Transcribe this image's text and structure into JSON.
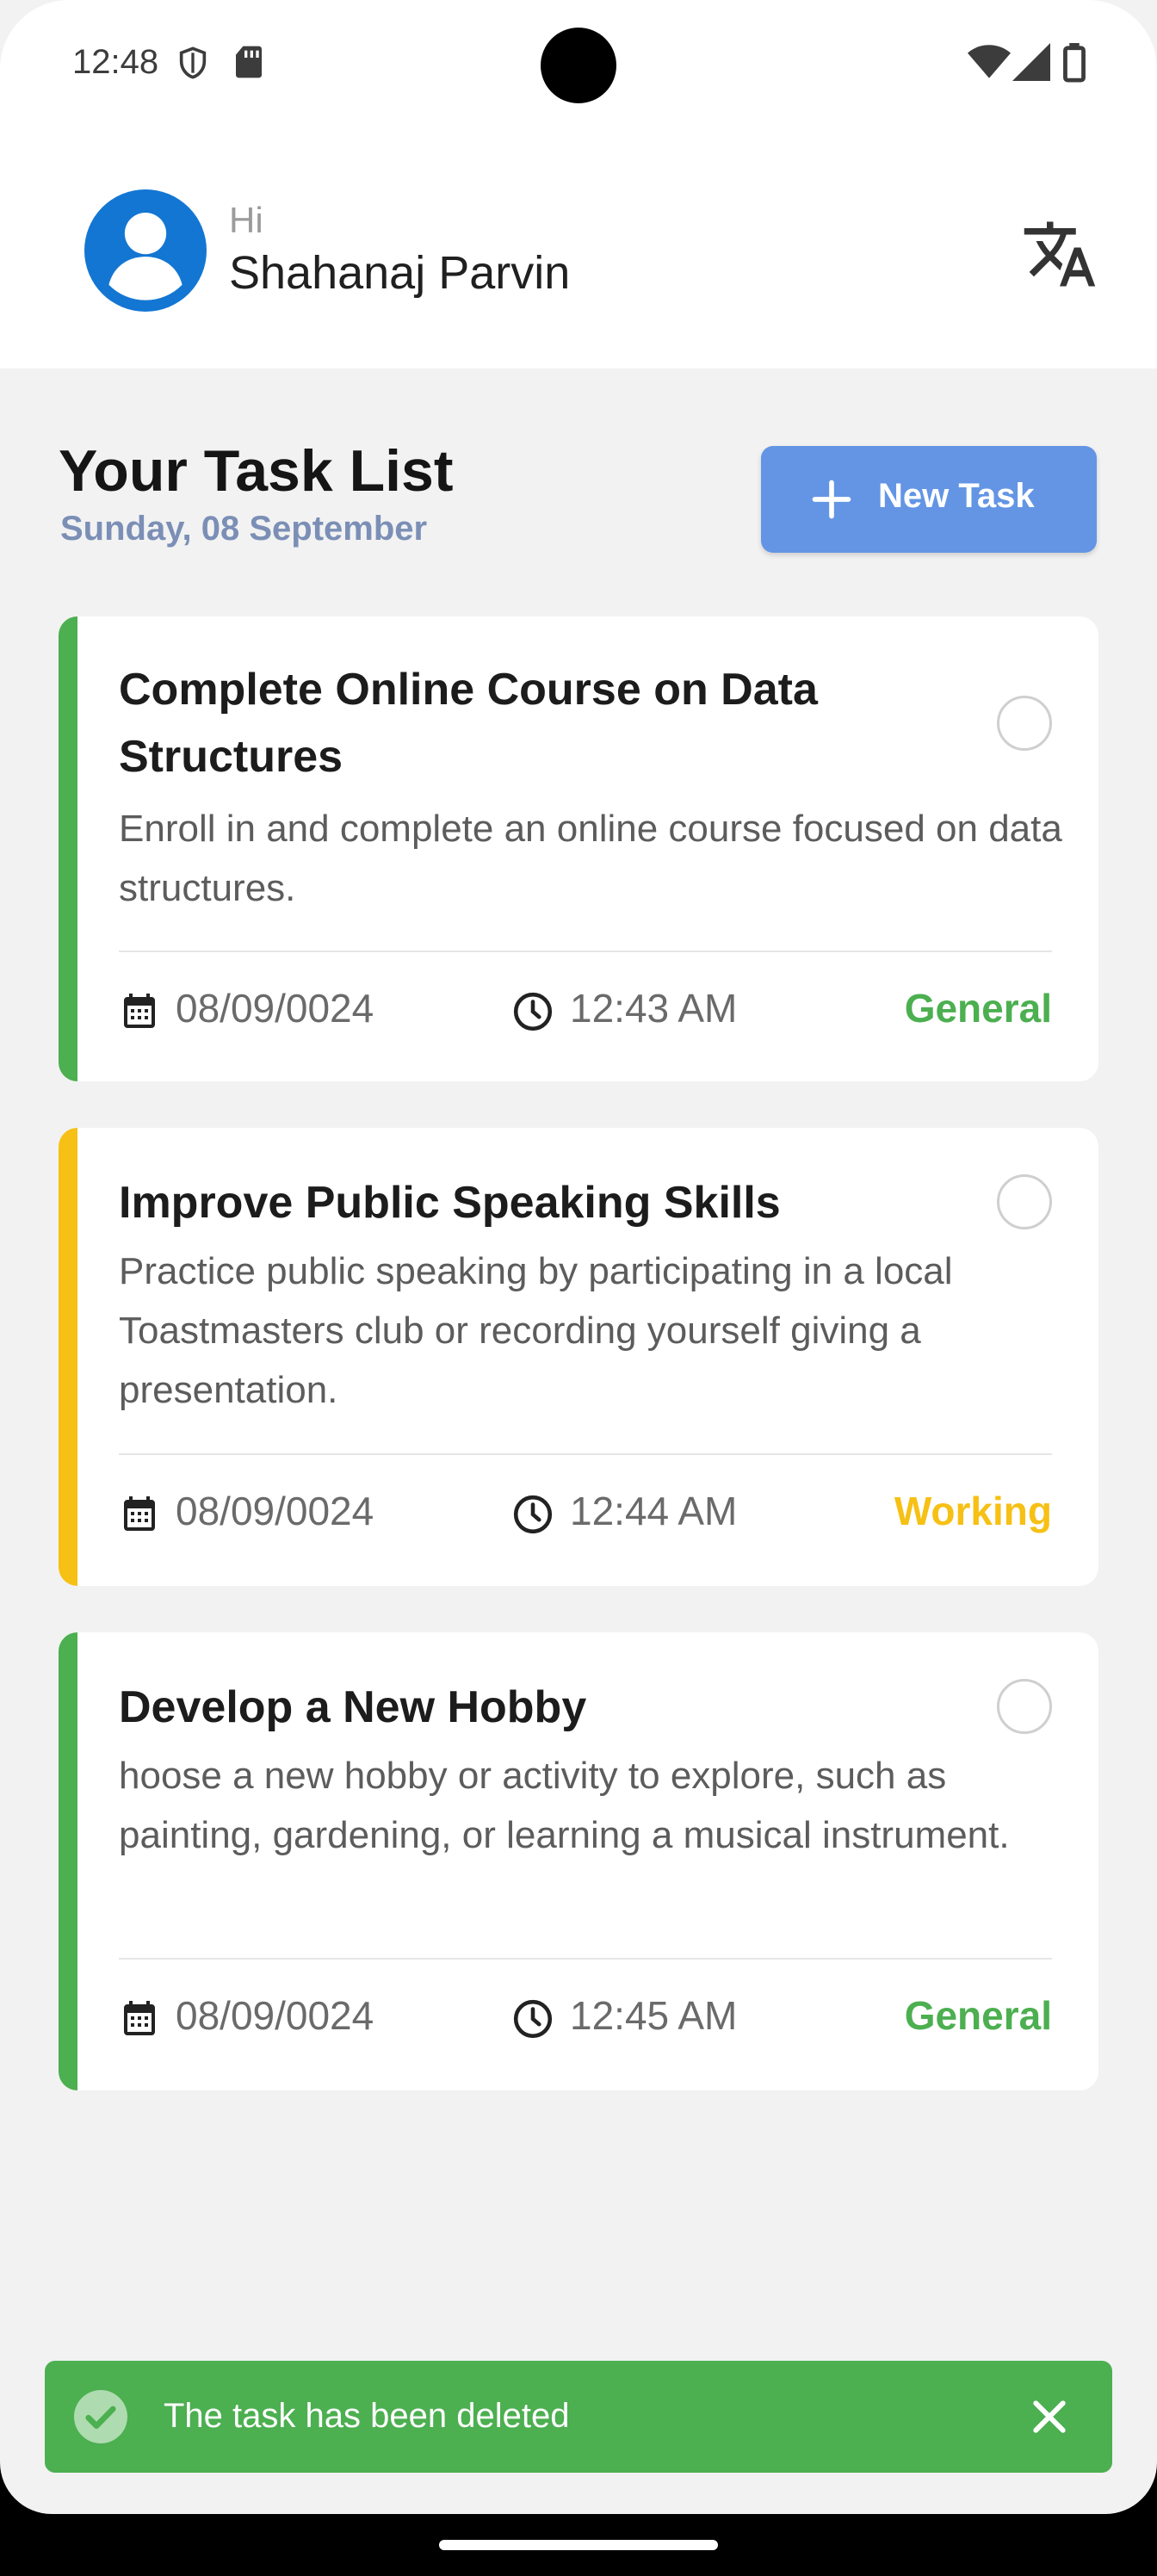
{
  "status_bar": {
    "time": "12:48"
  },
  "header": {
    "greeting": "Hi",
    "user_name": "Shahanaj Parvin"
  },
  "page": {
    "title": "Your Task List",
    "date": "Sunday, 08 September",
    "new_task_label": "New Task"
  },
  "tasks": [
    {
      "title": "Complete Online Course on Data Structures",
      "description": "Enroll in and complete an online course focused on data structures.",
      "date": "08/09/0024",
      "time": "12:43 AM",
      "category": "General",
      "color": "#4caf50"
    },
    {
      "title": "Improve Public Speaking Skills",
      "description": "Practice public speaking by participating in a local Toastmasters club or recording yourself giving a presentation.",
      "date": "08/09/0024",
      "time": "12:44 AM",
      "category": "Working",
      "color": "#f6c015"
    },
    {
      "title": "Develop a New Hobby",
      "description": "hoose a new hobby or activity to explore, such as painting, gardening, or learning a musical instrument.",
      "date": "08/09/0024",
      "time": "12:45 AM",
      "category": "General",
      "color": "#4caf50"
    }
  ],
  "snackbar": {
    "message": "The task has been deleted"
  },
  "icons": {
    "avatar": "person-circle-icon",
    "translate": "translate-icon",
    "calendar": "calendar-icon",
    "clock": "clock-icon",
    "success": "check-circle-icon",
    "close": "close-icon"
  }
}
